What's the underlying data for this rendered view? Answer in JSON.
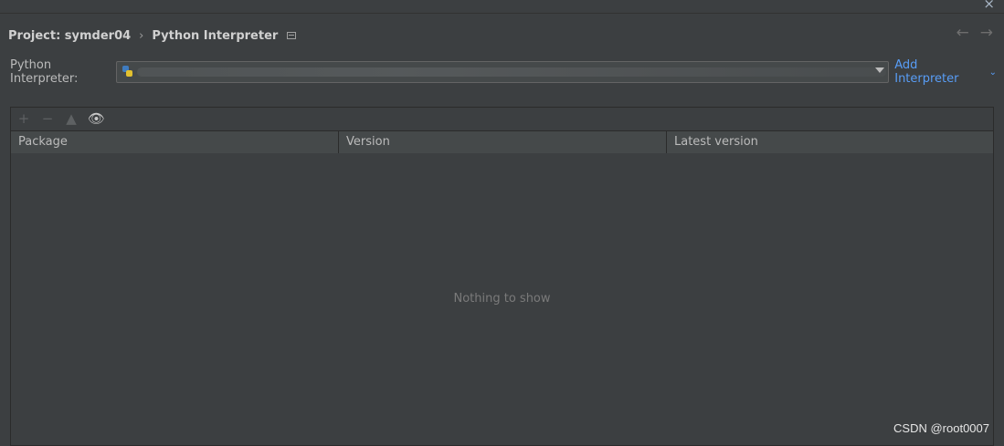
{
  "window": {
    "close_glyph": "×"
  },
  "breadcrumb": {
    "project": "Project: symder04",
    "separator": "›",
    "page": "Python Interpreter"
  },
  "nav": {
    "back": "←",
    "forward": "→"
  },
  "interpreter": {
    "label": "Python Interpreter:",
    "value": "",
    "add_label": "Add Interpreter",
    "add_chevron": "⌄"
  },
  "toolbar": {
    "add": "+",
    "remove": "−",
    "upgrade": "▲",
    "eye": "👁"
  },
  "table": {
    "columns": [
      "Package",
      "Version",
      "Latest version"
    ],
    "rows": [],
    "empty_text": "Nothing to show"
  },
  "watermark": "CSDN @root0007",
  "colors": {
    "background": "#3c3f41",
    "accent": "#589df6",
    "header_bg": "#45494a"
  }
}
